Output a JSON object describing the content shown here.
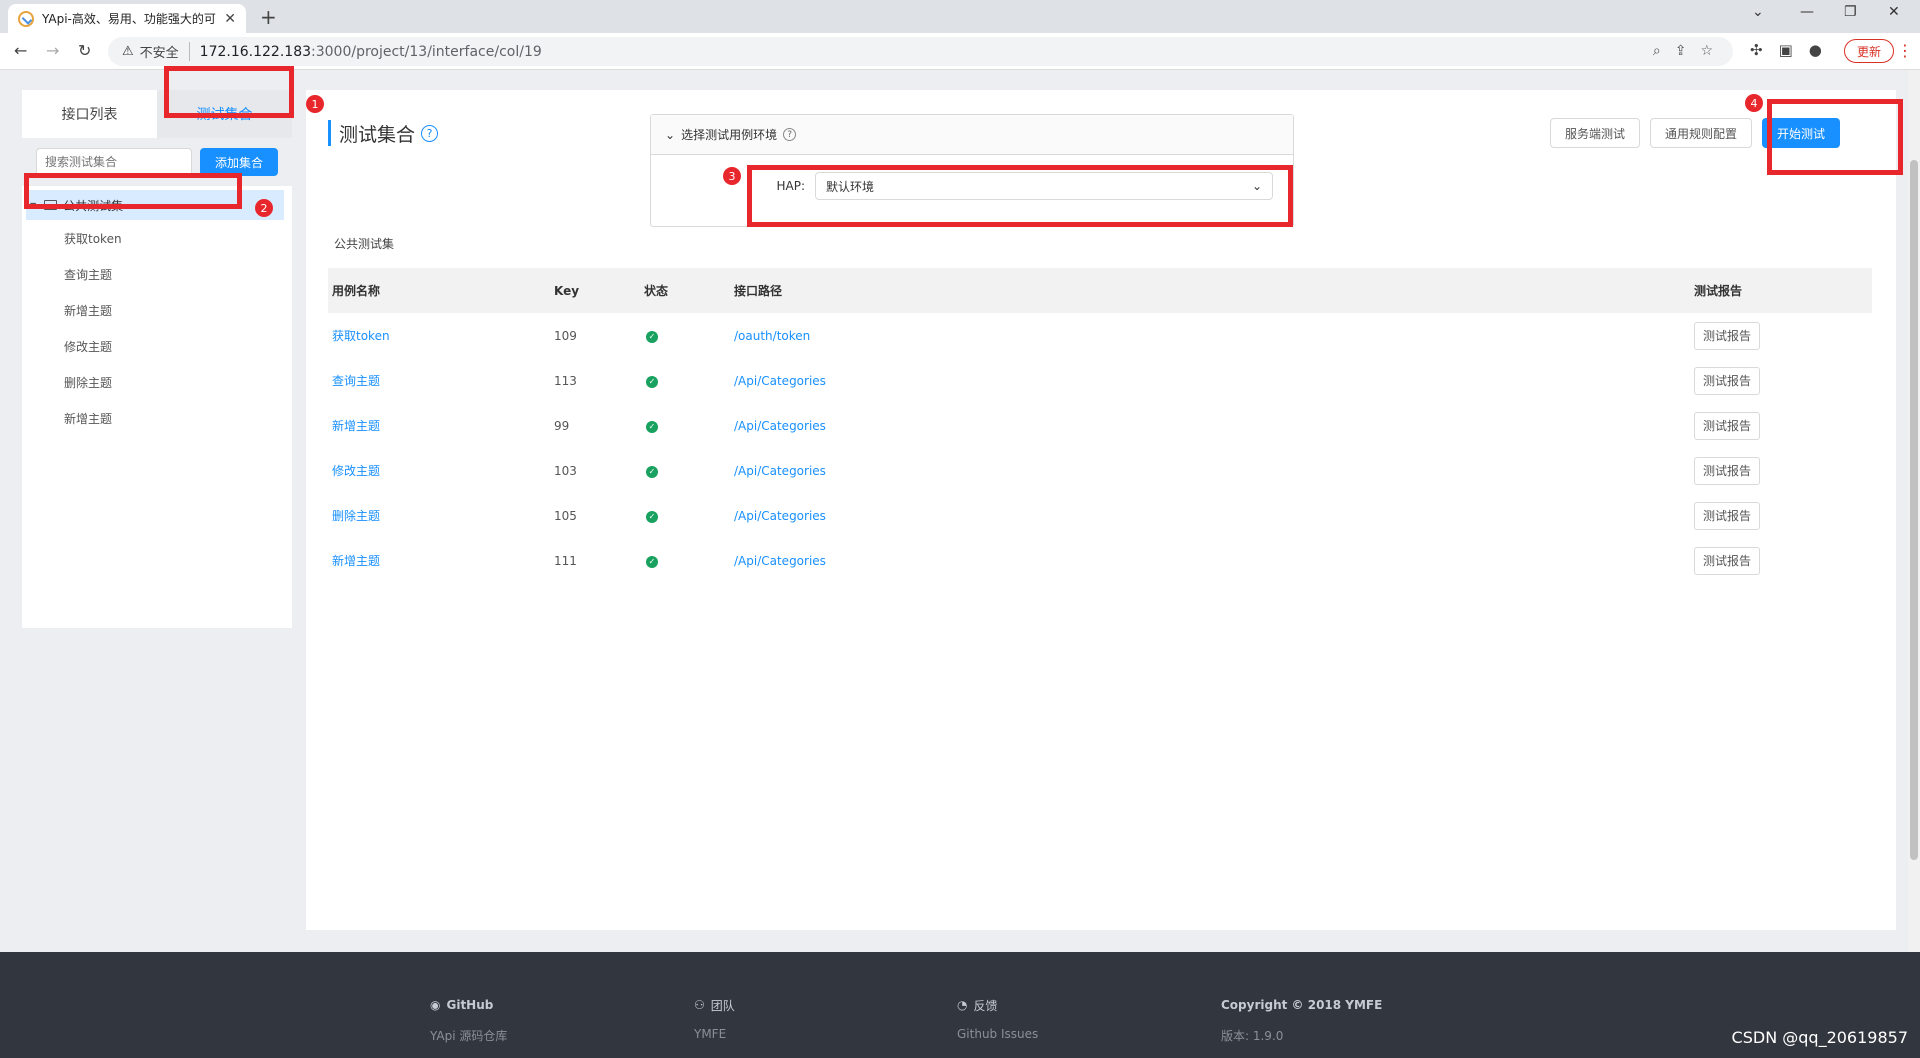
{
  "browser": {
    "tab_title": "YApi-高效、易用、功能强大的可",
    "tab_close": "✕",
    "new_tab": "+",
    "insecure_label": "不安全",
    "url_host": "172.16.122.183",
    "url_path": ":3000/project/13/interface/col/19",
    "update_label": "更新",
    "controls": {
      "dropdown": "⌄",
      "minimize": "—",
      "restore": "❐",
      "close": "✕"
    }
  },
  "sidebar": {
    "tabs": [
      {
        "label": "接口列表"
      },
      {
        "label": "测试集合"
      }
    ],
    "search_placeholder": "搜索测试集合",
    "add_collection_label": "添加集合",
    "root": {
      "label": "公共测试集"
    },
    "items": [
      {
        "label": "获取token"
      },
      {
        "label": "查询主题"
      },
      {
        "label": "新增主题"
      },
      {
        "label": "修改主题"
      },
      {
        "label": "删除主题"
      },
      {
        "label": "新增主题"
      }
    ]
  },
  "main": {
    "title": "测试集合",
    "env_panel": {
      "header": "选择测试用例环境",
      "label": "HAP:",
      "value": "默认环境"
    },
    "actions": {
      "server_test": "服务端测试",
      "rule_config": "通用规则配置",
      "start_test": "开始测试"
    },
    "collection_name": "公共测试集",
    "table": {
      "headers": [
        "用例名称",
        "Key",
        "状态",
        "接口路径",
        "测试报告"
      ],
      "rows": [
        {
          "name": "获取token",
          "key": "109",
          "path": "/oauth/token",
          "report": "测试报告"
        },
        {
          "name": "查询主题",
          "key": "113",
          "path": "/Api/Categories",
          "report": "测试报告"
        },
        {
          "name": "新增主题",
          "key": "99",
          "path": "/Api/Categories",
          "report": "测试报告"
        },
        {
          "name": "修改主题",
          "key": "103",
          "path": "/Api/Categories",
          "report": "测试报告"
        },
        {
          "name": "删除主题",
          "key": "105",
          "path": "/Api/Categories",
          "report": "测试报告"
        },
        {
          "name": "新增主题",
          "key": "111",
          "path": "/Api/Categories",
          "report": "测试报告"
        }
      ]
    }
  },
  "annotations": [
    "1",
    "2",
    "3",
    "4"
  ],
  "footer": {
    "github": {
      "title": "GitHub",
      "link": "YApi 源码仓库"
    },
    "team": {
      "title": "团队",
      "link": "YMFE"
    },
    "feedback": {
      "title": "反馈",
      "link": "Github Issues"
    },
    "copyright": {
      "title": "Copyright © 2018 YMFE",
      "version": "版本: 1.9.0"
    },
    "watermark": "CSDN @qq_20619857"
  },
  "colors": {
    "accent": "#1890ff",
    "annotation": "#e8272d",
    "success": "#19a15f",
    "footer_bg": "#32363f"
  }
}
